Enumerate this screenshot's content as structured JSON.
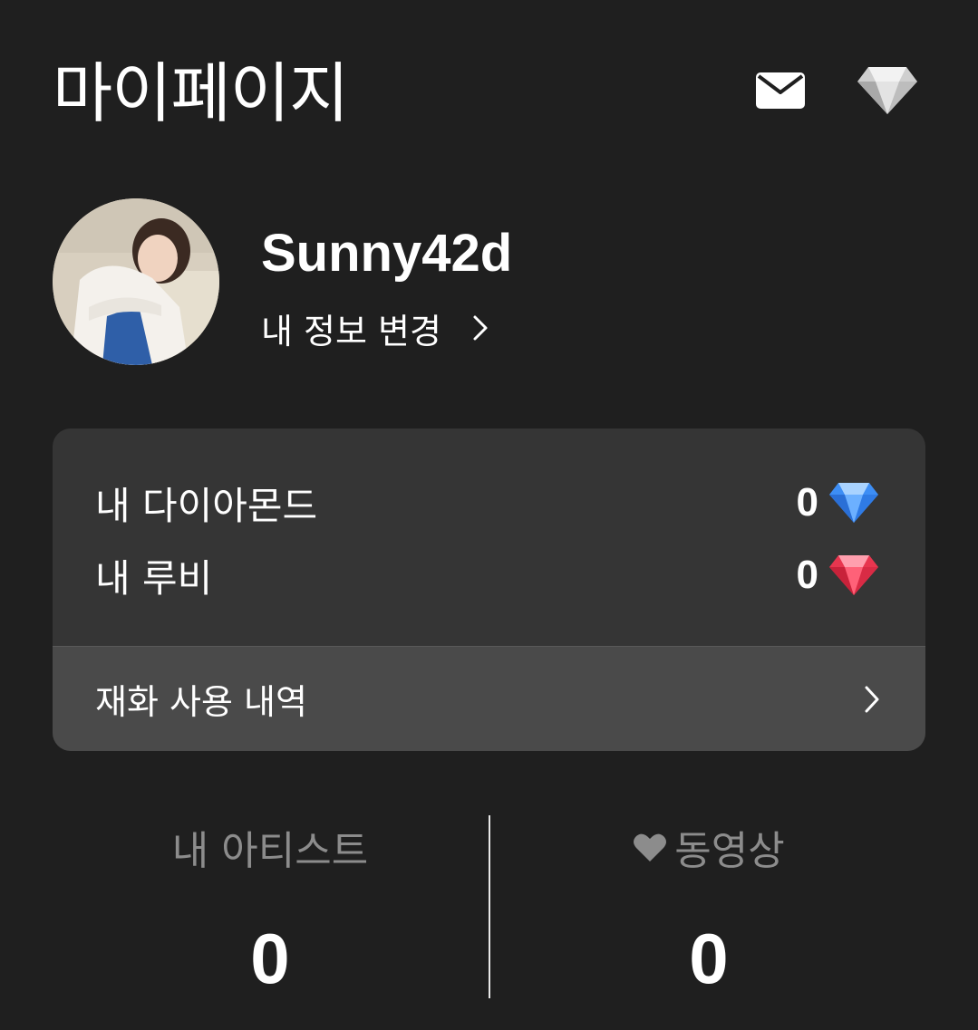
{
  "header": {
    "title": "마이페이지",
    "icons": [
      "mail-icon",
      "diamond-icon"
    ]
  },
  "profile": {
    "username": "Sunny42d",
    "edit_label": "내 정보 변경"
  },
  "wallet": {
    "diamonds_label": "내 다이아몬드",
    "diamonds_value": "0",
    "rubies_label": "내 루비",
    "rubies_value": "0",
    "history_label": "재화 사용 내역",
    "colors": {
      "card_bg": "#353535",
      "history_bg": "#4a4a4a",
      "diamond": "#3d8ef5",
      "ruby": "#e8364f"
    }
  },
  "stats": {
    "artists_label": "내 아티스트",
    "artists_value": "0",
    "videos_label": "동영상",
    "videos_value": "0"
  }
}
